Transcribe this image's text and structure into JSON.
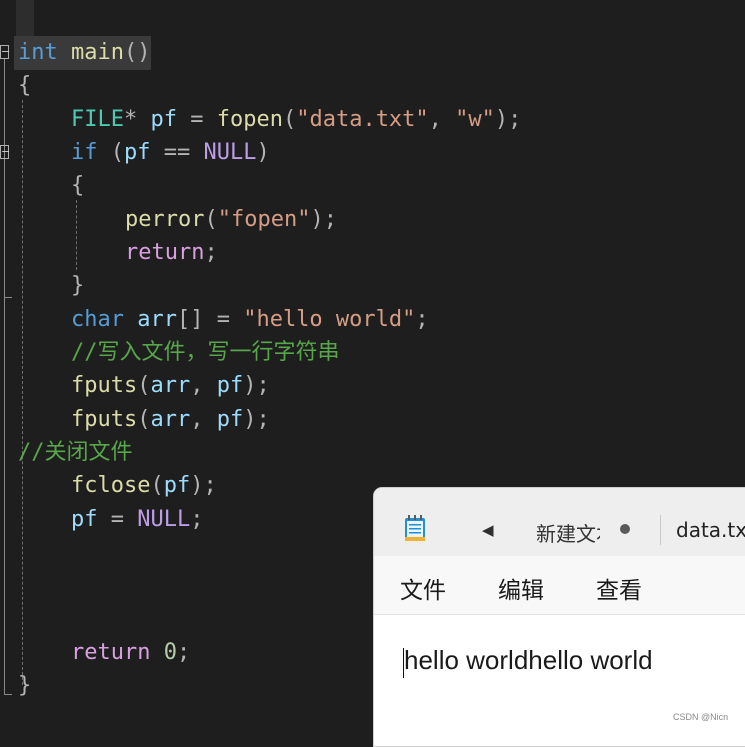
{
  "editor": {
    "lines": [
      [
        {
          "t": "int",
          "c": "kw"
        },
        {
          "t": " main",
          "c": "fn"
        },
        {
          "t": "()",
          "c": "pun"
        }
      ],
      [
        {
          "t": "{",
          "c": "pun"
        }
      ],
      [
        {
          "t": "FILE",
          "c": "ty"
        },
        {
          "t": "* ",
          "c": "op"
        },
        {
          "t": "pf",
          "c": "var"
        },
        {
          "t": " = ",
          "c": "op"
        },
        {
          "t": "fopen",
          "c": "fn"
        },
        {
          "t": "(",
          "c": "pun"
        },
        {
          "t": "\"data.txt\"",
          "c": "str"
        },
        {
          "t": ", ",
          "c": "pun"
        },
        {
          "t": "\"w\"",
          "c": "str"
        },
        {
          "t": ");",
          "c": "pun"
        }
      ],
      [
        {
          "t": "if",
          "c": "kw"
        },
        {
          "t": " (",
          "c": "pun"
        },
        {
          "t": "pf",
          "c": "var"
        },
        {
          "t": " == ",
          "c": "op"
        },
        {
          "t": "NULL",
          "c": "mac"
        },
        {
          "t": ")",
          "c": "pun"
        }
      ],
      [
        {
          "t": "{",
          "c": "pun"
        }
      ],
      [
        {
          "t": "perror",
          "c": "fn"
        },
        {
          "t": "(",
          "c": "pun"
        },
        {
          "t": "\"fopen\"",
          "c": "str"
        },
        {
          "t": ");",
          "c": "pun"
        }
      ],
      [
        {
          "t": "return",
          "c": "ctl"
        },
        {
          "t": ";",
          "c": "pun"
        }
      ],
      [
        {
          "t": "}",
          "c": "pun"
        }
      ],
      [
        {
          "t": "char",
          "c": "kw"
        },
        {
          "t": " arr",
          "c": "var"
        },
        {
          "t": "[] = ",
          "c": "pun"
        },
        {
          "t": "\"hello world\"",
          "c": "str"
        },
        {
          "t": ";",
          "c": "pun"
        }
      ],
      [
        {
          "t": "//写入文件，写一行字符串",
          "c": "cmt"
        }
      ],
      [
        {
          "t": "fputs",
          "c": "fn"
        },
        {
          "t": "(",
          "c": "pun"
        },
        {
          "t": "arr",
          "c": "var"
        },
        {
          "t": ", ",
          "c": "pun"
        },
        {
          "t": "pf",
          "c": "var"
        },
        {
          "t": ");",
          "c": "pun"
        }
      ],
      [
        {
          "t": "fputs",
          "c": "fn"
        },
        {
          "t": "(",
          "c": "pun"
        },
        {
          "t": "arr",
          "c": "var"
        },
        {
          "t": ", ",
          "c": "pun"
        },
        {
          "t": "pf",
          "c": "var"
        },
        {
          "t": ");",
          "c": "pun"
        }
      ],
      [
        {
          "t": "//关闭文件",
          "c": "cmt"
        }
      ],
      [
        {
          "t": "fclose",
          "c": "fn"
        },
        {
          "t": "(",
          "c": "pun"
        },
        {
          "t": "pf",
          "c": "var"
        },
        {
          "t": ");",
          "c": "pun"
        }
      ],
      [
        {
          "t": "pf",
          "c": "var"
        },
        {
          "t": " = ",
          "c": "op"
        },
        {
          "t": "NULL",
          "c": "mac"
        },
        {
          "t": ";",
          "c": "pun"
        }
      ],
      [
        {
          "t": "return",
          "c": "ctl"
        },
        {
          "t": " ",
          "c": "pun"
        },
        {
          "t": "0",
          "c": "num"
        },
        {
          "t": ";",
          "c": "pun"
        }
      ],
      [
        {
          "t": "}",
          "c": "pun"
        }
      ]
    ],
    "fold_collapse_glyph": "−"
  },
  "notepad": {
    "tab_unsaved": "新建文本文档",
    "tab_active": "data.txt",
    "back_glyph": "◀",
    "menu_file": "文件",
    "menu_edit": "编辑",
    "menu_view": "查看",
    "content_text": "hello worldhello world",
    "icons": {
      "app": "notepad-icon",
      "back": "back-arrow-icon",
      "unsaved": "unsaved-dot-icon"
    }
  },
  "watermark": "CSDN @Nicn",
  "colors": {
    "editor_bg": "#1e1e1e",
    "keyword": "#569cd6",
    "function": "#dcdcaa",
    "type": "#4ec9b0",
    "variable": "#9cdcfe",
    "string": "#d69d85",
    "comment": "#57a64a",
    "macro": "#bd9ee6",
    "control": "#d8a0df",
    "number": "#b5cea8",
    "notepad_bg": "#f3f3f3",
    "notepad_content": "#ffffff"
  }
}
